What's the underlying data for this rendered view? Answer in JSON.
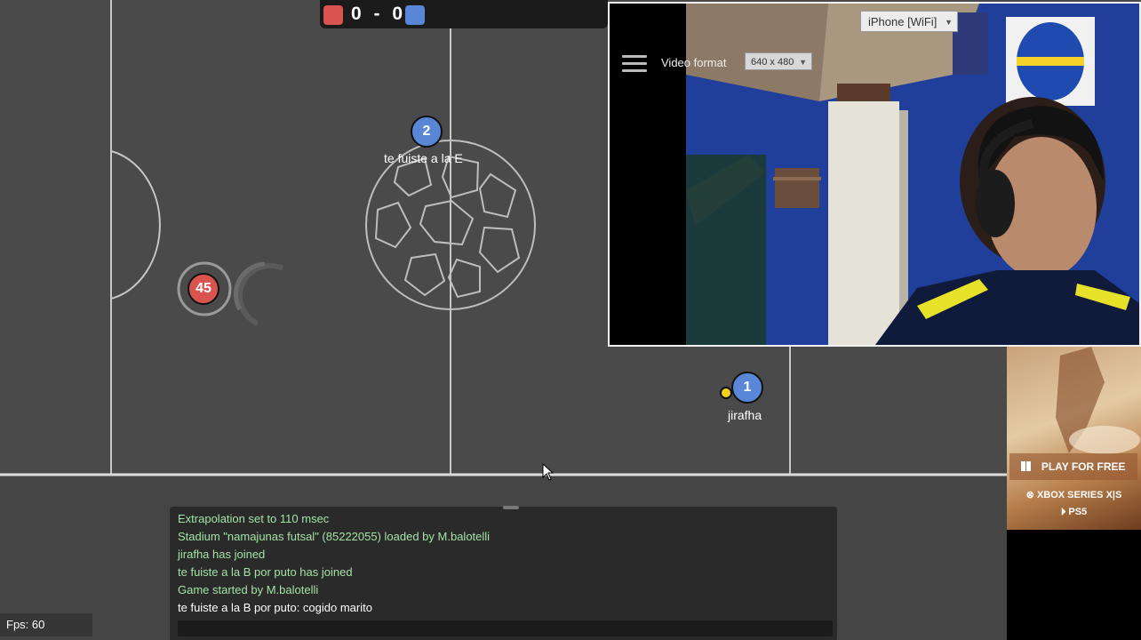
{
  "scoreboard": {
    "red_score": "0",
    "separator": "-",
    "blue_score": "0",
    "red_color": "#d9544f",
    "blue_color": "#5a86d8"
  },
  "players": [
    {
      "number": "2",
      "team": "blue",
      "name": "te fuiste a la E"
    },
    {
      "number": "45",
      "team": "red",
      "name": ""
    },
    {
      "number": "1",
      "team": "blue",
      "name": "jirafha"
    }
  ],
  "chat": {
    "lines": [
      "Extrapolation set to 110 msec",
      "Stadium \"namajunas futsal\" (85222055) loaded by M.balotelli",
      "jirafha has joined",
      "te fuiste a la B por puto has joined",
      "Game started by M.balotelli",
      "te fuiste a la B por puto: cogido marito"
    ]
  },
  "fps": "Fps: 60",
  "webcam": {
    "menu_icon": "hamburger-icon",
    "video_format_label": "Video format",
    "video_format_value": "640 x 480",
    "device_value": "iPhone [WiFi]"
  },
  "ad": {
    "cta": "PLAY FOR FREE",
    "platform1": "XBOX SERIES X|S",
    "platform2": "PS5"
  },
  "colors": {
    "field": "#4a4a4a",
    "lines": "#c7c7c7",
    "chat_system": "#a2e2a4"
  }
}
